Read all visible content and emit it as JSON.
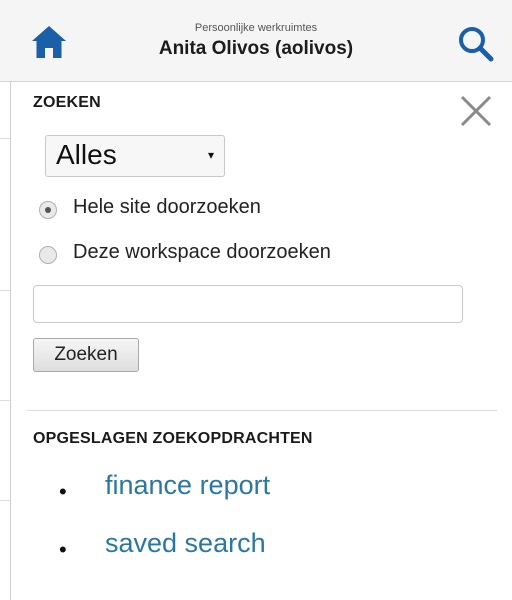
{
  "header": {
    "home_icon": "home-icon",
    "workspace_label": "Persoonlijke werkruimtes",
    "user_name": "Anita Olivos (aolivos)",
    "search_icon": "search-icon",
    "accent_color": "#1a5fa8"
  },
  "search_panel": {
    "title": "ZOEKEN",
    "close_icon": "close-icon",
    "scope_select": {
      "selected": "Alles",
      "arrow": "▾"
    },
    "radios": [
      {
        "label": "Hele site doorzoeken",
        "checked": true
      },
      {
        "label": "Deze workspace doorzoeken",
        "checked": false
      }
    ],
    "query_input": {
      "value": "",
      "placeholder": ""
    },
    "submit_label": "Zoeken"
  },
  "saved_searches": {
    "title": "OPGESLAGEN ZOEKOPDRACHTEN",
    "bullet": "•",
    "items": [
      {
        "label": "finance report"
      },
      {
        "label": "saved search"
      }
    ],
    "link_color": "#2b77a3"
  }
}
